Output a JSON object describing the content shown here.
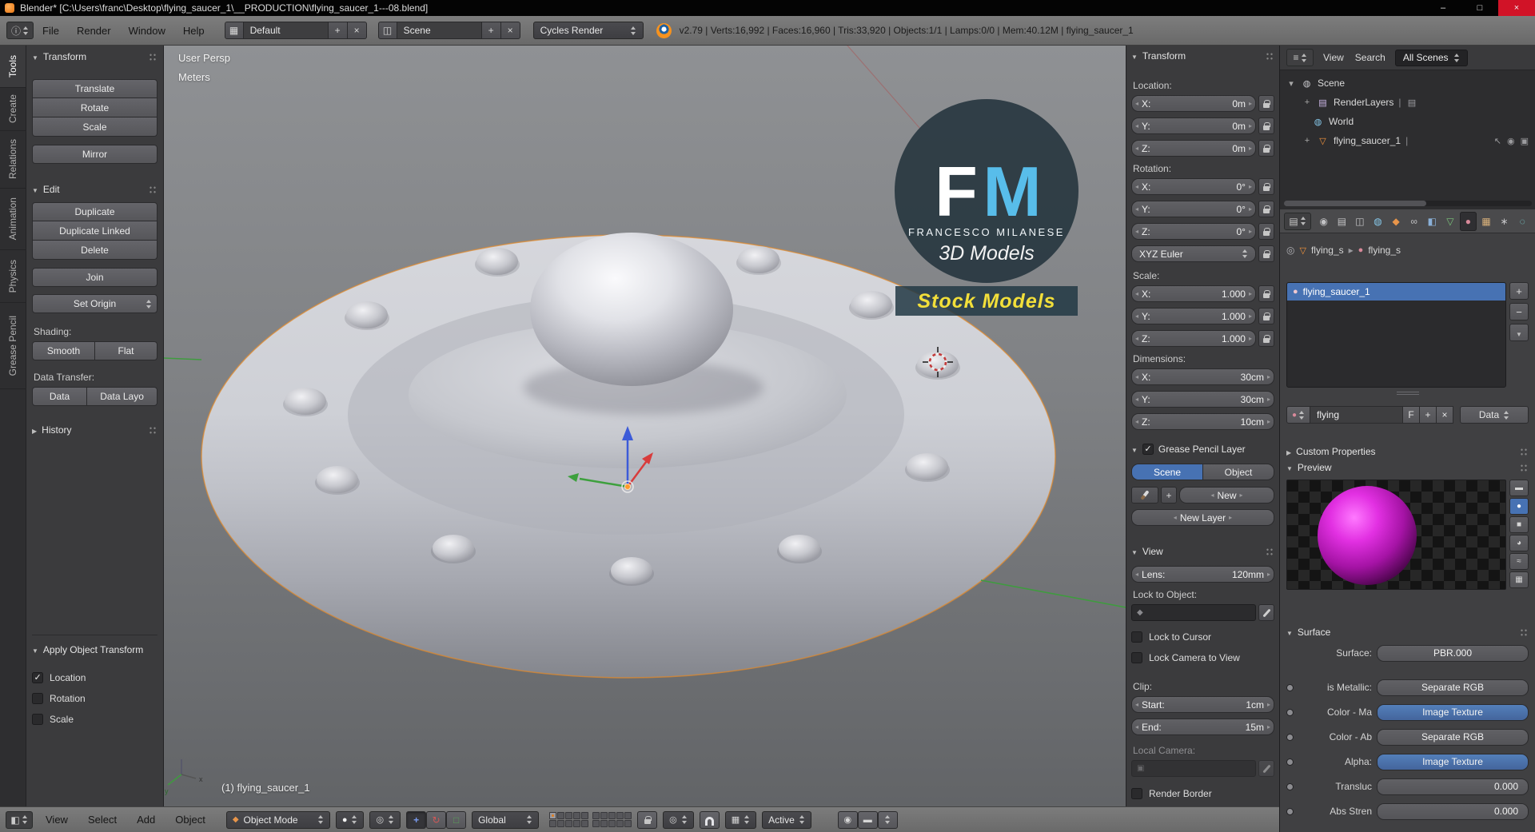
{
  "title_bar": {
    "title": "Blender* [C:\\Users\\franc\\Desktop\\flying_saucer_1\\__PRODUCTION\\flying_saucer_1---08.blend]"
  },
  "icons": {
    "minimize": "–",
    "maximize": "□",
    "close": "×",
    "plus": "+",
    "minus": "−",
    "cross": "×",
    "chev": "▸",
    "info_editor": "ⓘ",
    "outliner_editor": "≡",
    "view3d_editor": "◧",
    "props_editor": "▤",
    "layout_browse": "▦",
    "tab_render": "◉",
    "tab_layers": "▤",
    "tab_scene": "◫",
    "tab_world": "◍",
    "tab_object": "◆",
    "tab_constraint": "∞",
    "tab_modifier": "◧",
    "tab_data": "▽",
    "tab_material": "●",
    "tab_texture": "▦",
    "tab_particles": "∗",
    "tab_physics": "◌",
    "ol_scene": "◍",
    "ol_image": "▤",
    "ol_world": "◍",
    "ol_mesh": "▽",
    "ol_pipe": "|",
    "eye": "◉",
    "pointer": "↖",
    "camera": "▣",
    "mat_sphere": "●",
    "node": "◎",
    "pv_flat": "▬",
    "pv_sphere": "●",
    "pv_cube": "■",
    "pv_monkey": "◕",
    "pv_hair": "≈",
    "pv_checker": "▦",
    "mode_cube": "◆",
    "shade_sphere": "●",
    "pivot": "◎",
    "manip_translate": "+",
    "manip_rotate": "↻",
    "manip_scale": "□",
    "prop_edit": "◎",
    "snap_element": "▦",
    "render_still": "◉",
    "render_anim": "▬"
  },
  "info_header": {
    "menu_file": "File",
    "menu_render": "Render",
    "menu_window": "Window",
    "menu_help": "Help",
    "layout_value": "Default",
    "scene_value": "Scene",
    "engine_value": "Cycles Render",
    "stats": "v2.79 | Verts:16,992 | Faces:16,960 | Tris:33,920 | Objects:1/1 | Lamps:0/0 | Mem:40.12M | flying_saucer_1"
  },
  "tool_shelf": {
    "tabs": [
      "Tools",
      "Create",
      "Relations",
      "Animation",
      "Physics",
      "Grease Pencil"
    ],
    "transform_title": "Transform",
    "translate": "Translate",
    "rotate": "Rotate",
    "scale": "Scale",
    "mirror": "Mirror",
    "edit_title": "Edit",
    "duplicate": "Duplicate",
    "duplicate_linked": "Duplicate Linked",
    "delete": "Delete",
    "join": "Join",
    "set_origin": "Set Origin",
    "shading_label": "Shading:",
    "smooth": "Smooth",
    "flat": "Flat",
    "data_transfer_label": "Data Transfer:",
    "data": "Data",
    "data_layout": "Data Layo",
    "history_title": "History",
    "apply_title": "Apply Object Transform",
    "apply_location": "Location",
    "apply_rotation": "Rotation",
    "apply_scale": "Scale"
  },
  "viewport": {
    "view_label": "User Persp",
    "units_label": "Meters",
    "object_info": "(1) flying_saucer_1",
    "watermark": {
      "f": "F",
      "m": "M",
      "name": "FRANCESCO MILANESE",
      "models": "3D Models",
      "stock": "Stock Models"
    }
  },
  "n_panel": {
    "transform_title": "Transform",
    "location_label": "Location:",
    "loc": [
      {
        "a": "X:",
        "v": "0m"
      },
      {
        "a": "Y:",
        "v": "0m"
      },
      {
        "a": "Z:",
        "v": "0m"
      }
    ],
    "rotation_label": "Rotation:",
    "rot": [
      {
        "a": "X:",
        "v": "0°"
      },
      {
        "a": "Y:",
        "v": "0°"
      },
      {
        "a": "Z:",
        "v": "0°"
      }
    ],
    "rotation_mode": "XYZ Euler",
    "scale_label": "Scale:",
    "scl": [
      {
        "a": "X:",
        "v": "1.000"
      },
      {
        "a": "Y:",
        "v": "1.000"
      },
      {
        "a": "Z:",
        "v": "1.000"
      }
    ],
    "dimensions_label": "Dimensions:",
    "dim": [
      {
        "a": "X:",
        "v": "30cm"
      },
      {
        "a": "Y:",
        "v": "30cm"
      },
      {
        "a": "Z:",
        "v": "10cm"
      }
    ],
    "gp_title": "Grease Pencil Layer",
    "gp_scene": "Scene",
    "gp_object": "Object",
    "gp_new": "New",
    "gp_new_layer": "New Layer",
    "view_title": "View",
    "lens_label": "Lens:",
    "lens_value": "120mm",
    "lock_to_object": "Lock to Object:",
    "lock_to_cursor": "Lock to Cursor",
    "lock_camera_to_view": "Lock Camera to View",
    "clip_label": "Clip:",
    "clip_start_label": "Start:",
    "clip_start_value": "1cm",
    "clip_end_label": "End:",
    "clip_end_value": "15m",
    "local_camera_label": "Local Camera:",
    "render_border": "Render Border"
  },
  "outliner": {
    "menu_view": "View",
    "menu_search": "Search",
    "scenes_filter": "All Scenes",
    "scene": "Scene",
    "render_layers": "RenderLayers",
    "world": "World",
    "object": "flying_saucer_1"
  },
  "properties": {
    "breadcrumb_obj": "flying_s",
    "breadcrumb_mat": "flying_s",
    "slot_name": "flying_saucer_1",
    "mat_name": "flying",
    "fake_user": "F",
    "data_btn": "Data",
    "custom_props_title": "Custom Properties",
    "preview_title": "Preview",
    "surface_title": "Surface",
    "rows": [
      {
        "label": "Surface:",
        "value": "PBR.000"
      },
      {
        "label": "is Metallic:",
        "value": "Separate RGB"
      },
      {
        "label": "Color - Ma",
        "value": "Image Texture"
      },
      {
        "label": "Color - Ab",
        "value": "Separate RGB"
      },
      {
        "label": "Alpha:",
        "value": "Image Texture"
      },
      {
        "label": "Transluc",
        "value": "0.000"
      },
      {
        "label": "Abs Stren",
        "value": "0.000"
      }
    ]
  },
  "view3d_header": {
    "menu_view": "View",
    "menu_select": "Select",
    "menu_add": "Add",
    "menu_object": "Object",
    "mode": "Object Mode",
    "orientation": "Global",
    "snap_target": "Active"
  }
}
